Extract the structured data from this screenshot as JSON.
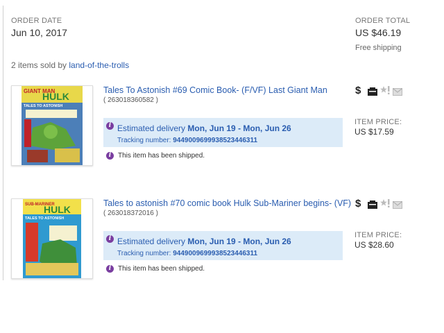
{
  "order": {
    "date_label": "ORDER DATE",
    "date_value": "Jun 10, 2017",
    "total_label": "ORDER TOTAL",
    "total_value": "US $46.19",
    "shipping": "Free shipping"
  },
  "seller": {
    "prefix": "2 items sold by",
    "name": "land-of-the-trolls"
  },
  "items": [
    {
      "title": "Tales To Astonish #69 Comic Book- (F/VF) Last Giant Man",
      "id": "( 263018360582 )",
      "est_prefix": "Estimated delivery",
      "est_range": "Mon, Jun 19 - Mon, Jun 26",
      "tracking_label": "Tracking number:",
      "tracking_number": "9449009699938523446311",
      "shipped": "This item has been shipped.",
      "price_label": "ITEM PRICE:",
      "price_value": "US $17.59",
      "cover_top": "GIANT MAN",
      "cover_hulk": "HULK",
      "cover_series": "TALES TO ASTONISH"
    },
    {
      "title": "Tales to astonish #70 comic book Hulk Sub-Mariner begins- (VF)",
      "id": "( 263018372016 )",
      "est_prefix": "Estimated delivery",
      "est_range": "Mon, Jun 19 - Mon, Jun 26",
      "tracking_label": "Tracking number:",
      "tracking_number": "9449009699938523446311",
      "shipped": "This item has been shipped.",
      "price_label": "ITEM PRICE:",
      "price_value": "US $28.60",
      "cover_top": "SUB-MARINER",
      "cover_hulk": "HULK",
      "cover_series": "TALES TO ASTONISH"
    }
  ],
  "icons": {
    "info": "i",
    "dollar": "$"
  },
  "colors": {
    "link": "#2a5db0",
    "info_purple": "#7a3ea0",
    "delivery_bg": "#dcebf8"
  }
}
